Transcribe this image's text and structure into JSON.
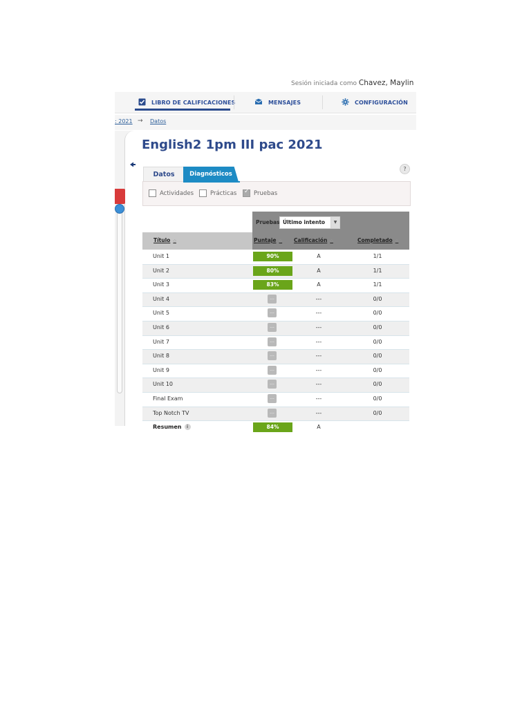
{
  "session": {
    "label": "Sesión iniciada como",
    "user": "Chavez, Maylin"
  },
  "nav": {
    "gradebook": "LIBRO DE CALIFICACIONES",
    "messages": "MENSAJES",
    "settings": "CONFIGURACIÓN",
    "active": "gradebook"
  },
  "breadcrumb": {
    "course": ": 2021",
    "arrow": "→",
    "current": "Datos"
  },
  "page_title": "English2 1pm III pac 2021",
  "help": "?",
  "tabs": {
    "datos": "Datos",
    "diagnosticos": "Diagnósticos"
  },
  "filters": [
    {
      "label": "Actividades",
      "checked": false
    },
    {
      "label": "Prácticas",
      "checked": false
    },
    {
      "label": "Pruebas",
      "checked": true
    }
  ],
  "table": {
    "control_label": "Pruebas",
    "attempt_select": "Último intento",
    "headers": {
      "title": "Título",
      "score": "Puntaje",
      "grade": "Calificación",
      "completed": "Completado"
    },
    "rows": [
      {
        "name": "Unit 1",
        "score": "90%",
        "grade": "A",
        "completed": "1/1"
      },
      {
        "name": "Unit 2",
        "score": "80%",
        "grade": "A",
        "completed": "1/1"
      },
      {
        "name": "Unit 3",
        "score": "83%",
        "grade": "A",
        "completed": "1/1"
      },
      {
        "name": "Unit 4",
        "score": "---",
        "grade": "---",
        "completed": "0/0"
      },
      {
        "name": "Unit 5",
        "score": "---",
        "grade": "---",
        "completed": "0/0"
      },
      {
        "name": "Unit 6",
        "score": "---",
        "grade": "---",
        "completed": "0/0"
      },
      {
        "name": "Unit 7",
        "score": "---",
        "grade": "---",
        "completed": "0/0"
      },
      {
        "name": "Unit 8",
        "score": "---",
        "grade": "---",
        "completed": "0/0"
      },
      {
        "name": "Unit 9",
        "score": "---",
        "grade": "---",
        "completed": "0/0"
      },
      {
        "name": "Unit 10",
        "score": "---",
        "grade": "---",
        "completed": "0/0"
      },
      {
        "name": "Final Exam",
        "score": "---",
        "grade": "---",
        "completed": "0/0"
      },
      {
        "name": "Top Notch TV",
        "score": "---",
        "grade": "---",
        "completed": "0/0"
      }
    ],
    "summary": {
      "name": "Resumen",
      "score": "84%",
      "grade": "A",
      "info": "i"
    }
  },
  "colors": {
    "accent": "#2e4a8b",
    "tab_active": "#1d8bc4",
    "score_good": "#6aa51a",
    "alert": "#d83a3a"
  }
}
